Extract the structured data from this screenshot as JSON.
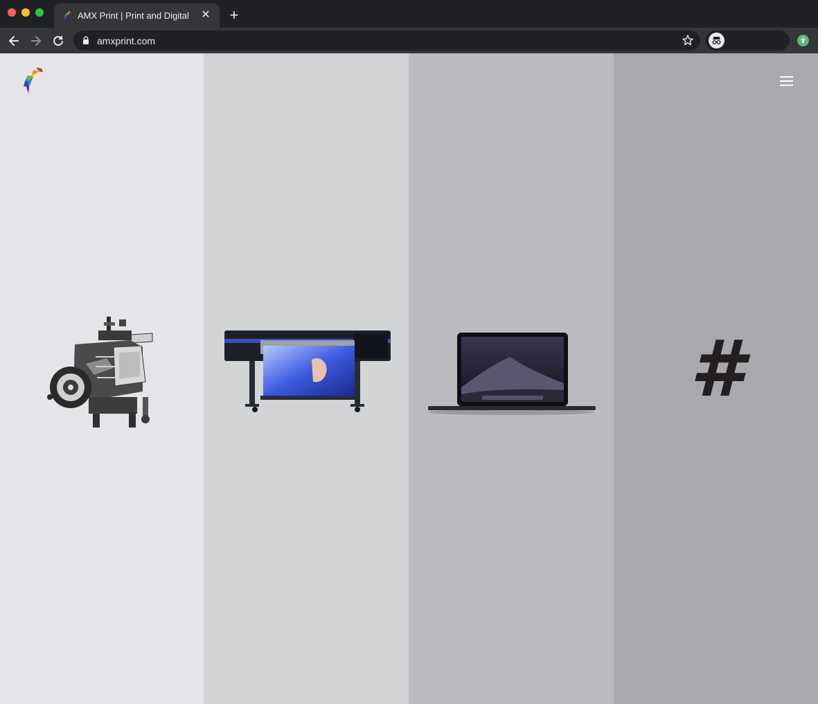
{
  "browser": {
    "tab_title": "AMX Print | Print and Digital",
    "tab_close_glyph": "✕",
    "new_tab_glyph": "+",
    "url": "amxprint.com",
    "icons": [
      "back-arrow-icon",
      "forward-arrow-icon",
      "reload-icon",
      "lock-icon",
      "star-icon",
      "incognito-icon",
      "update-icon"
    ]
  },
  "site": {
    "logo": "parrot-logo",
    "menu_icon": "hamburger-menu-icon",
    "panels": [
      {
        "name": "letterpress",
        "color": "#e4e5e8",
        "art": "vintage-printing-press-image"
      },
      {
        "name": "large-format",
        "color": "#d3d4d6",
        "art": "wide-format-printer-image"
      },
      {
        "name": "digital",
        "color": "#bbbcbf",
        "art": "laptop-image"
      },
      {
        "name": "social",
        "color": "#a8a9ac",
        "art": "hashtag-glyph",
        "glyph": "#"
      }
    ]
  },
  "colors": {
    "chrome_dark": "#202124",
    "chrome_toolbar": "#35363a",
    "chrome_text": "#e8eaed"
  }
}
